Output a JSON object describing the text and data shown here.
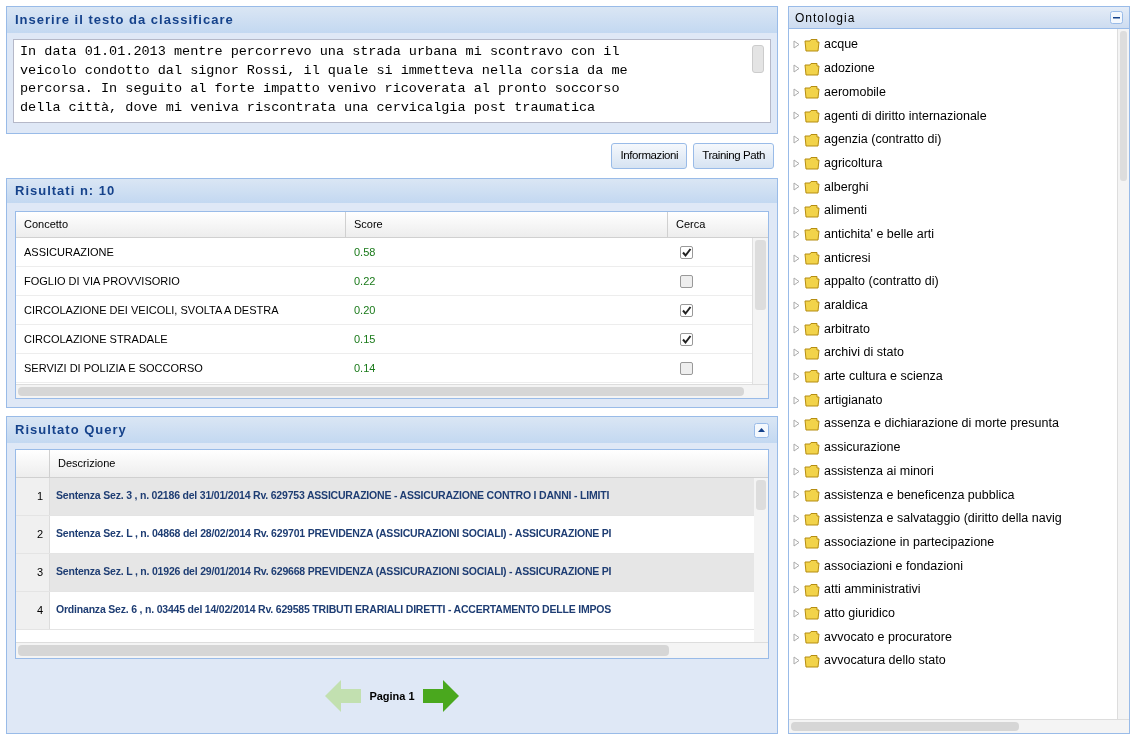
{
  "input_panel": {
    "title": "Inserire il testo da classificare",
    "text_lines": [
      "In data 01.01.2013 mentre percorrevo una strada urbana mi scontravo con il",
      "veicolo condotto dal signor Rossi, il quale si immetteva nella corsia da me",
      "percorsa. In seguito al forte impatto venivo ricoverata al pronto soccorso",
      "della città, dove mi veniva riscontrata una cervicalgia post traumatica"
    ]
  },
  "buttons": [
    "Informazioni",
    "Training Path"
  ],
  "results": {
    "title": "Risultati n: 10",
    "columns": [
      "Concetto",
      "Score",
      "Cerca"
    ],
    "rows": [
      {
        "concept": "ASSICURAZIONE",
        "score": "0.58",
        "checked": true
      },
      {
        "concept": "FOGLIO DI VIA PROVVISORIO",
        "score": "0.22",
        "checked": false
      },
      {
        "concept": "CIRCOLAZIONE DEI VEICOLI, SVOLTA A DESTRA",
        "score": "0.20",
        "checked": true
      },
      {
        "concept": "CIRCOLAZIONE STRADALE",
        "score": "0.15",
        "checked": true
      },
      {
        "concept": "SERVIZI DI POLIZIA E SOCCORSO",
        "score": "0.14",
        "checked": false
      }
    ]
  },
  "query": {
    "title": "Risultato Query",
    "columns": [
      "Descrizione"
    ],
    "rows": [
      {
        "number": "1",
        "text": "Sentenza Sez. 3 , n. 02186 del 31/01/2014 Rv. 629753 ASSICURAZIONE - ASSICURAZIONE CONTRO I DANNI - LIMITI",
        "selected": true
      },
      {
        "number": "2",
        "text": "Sentenza Sez. L , n. 04868 del 28/02/2014 Rv. 629701 PREVIDENZA (ASSICURAZIONI SOCIALI) - ASSICURAZIONE PI",
        "selected": false
      },
      {
        "number": "3",
        "text": "Sentenza Sez. L , n. 01926 del 29/01/2014 Rv. 629668 PREVIDENZA (ASSICURAZIONI SOCIALI) - ASSICURAZIONE PI",
        "selected": true
      },
      {
        "number": "4",
        "text": "Ordinanza Sez. 6 , n. 03445 del 14/02/2014 Rv. 629585 TRIBUTI ERARIALI DIRETTI - ACCERTAMENTO DELLE IMPOS",
        "selected": false
      }
    ],
    "pager": {
      "label": "Pagina 1",
      "prev_disabled": true,
      "next_disabled": false
    }
  },
  "ontology": {
    "title": "Ontologia",
    "items": [
      "acque",
      "adozione",
      "aeromobile",
      "agenti di diritto internazionale",
      "agenzia (contratto di)",
      "agricoltura",
      "alberghi",
      "alimenti",
      "antichita' e belle arti",
      "anticresi",
      "appalto (contratto di)",
      "araldica",
      "arbitrato",
      "archivi di stato",
      "arte cultura e scienza",
      "artigianato",
      "assenza e dichiarazione di morte presunta",
      "assicurazione",
      "assistenza ai minori",
      "assistenza e beneficenza pubblica",
      "assistenza e salvataggio (diritto della navig",
      "associazione in partecipazione",
      "associazioni e fondazioni",
      "atti amministrativi",
      "atto giuridico",
      "avvocato e procuratore",
      "avvocatura dello stato"
    ]
  }
}
